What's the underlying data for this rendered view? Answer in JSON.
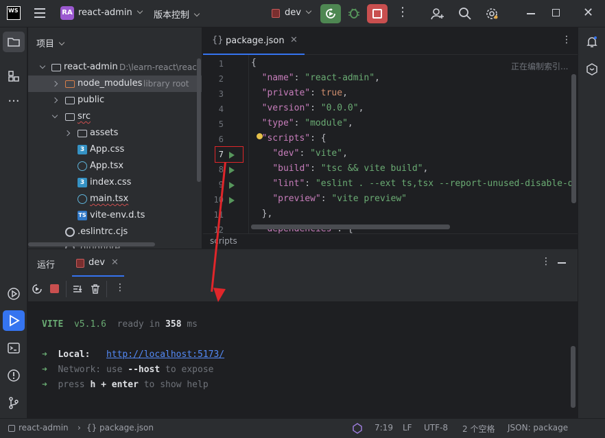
{
  "titlebar": {
    "logo": "WS",
    "project_badge": "RA",
    "project_name": "react-admin",
    "vcs_label": "版本控制",
    "run_config": "dev"
  },
  "project_panel": {
    "header": "项目",
    "root_name": "react-admin",
    "root_path": "D:\\learn-react\\react",
    "items": [
      {
        "name": "node_modules",
        "note": "library root"
      },
      {
        "name": "public"
      },
      {
        "name": "src"
      },
      {
        "name": "assets"
      },
      {
        "name": "App.css"
      },
      {
        "name": "App.tsx"
      },
      {
        "name": "index.css"
      },
      {
        "name": "main.tsx"
      },
      {
        "name": "vite-env.d.ts"
      },
      {
        "name": ".eslintrc.cjs"
      },
      {
        "name": ".gitignore"
      }
    ]
  },
  "editor": {
    "tab_name": "package.json",
    "indexing": "正在编制索引...",
    "line_numbers": [
      "1",
      "2",
      "3",
      "4",
      "5",
      "6",
      "7",
      "8",
      "9",
      "10",
      "11",
      "12"
    ],
    "breadcrumb": "scripts"
  },
  "run_panel": {
    "title": "运行",
    "tab_label": "dev",
    "console": {
      "vite_name": "VITE",
      "vite_version": "v5.1.6",
      "ready_text": "ready in",
      "ready_ms": "358",
      "ms_unit": "ms",
      "arrow": "➜",
      "local_label": "Local:",
      "local_url": "http://localhost:5173/",
      "network_label": "Network:",
      "network_use": "use",
      "network_flag": "--host",
      "network_rest": "to expose",
      "press": "press",
      "h_key": "h + enter",
      "help_rest": "to show help"
    }
  },
  "statusbar": {
    "project": "react-admin",
    "file": "package.json",
    "position": "7:19",
    "line_sep": "LF",
    "encoding": "UTF-8",
    "indent": "2 个空格",
    "filetype": "JSON: package"
  },
  "colors": {
    "accent": "#3574f0",
    "run_green": "#4e8752",
    "stop_red": "#c94f4f",
    "annotation_red": "#e0262a"
  }
}
